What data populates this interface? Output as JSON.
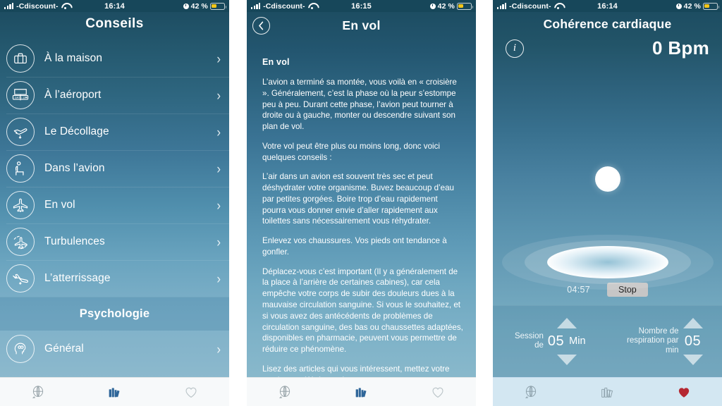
{
  "statusbars": [
    {
      "carrier": "-Cdiscount-",
      "time": "16:14",
      "battery": "42 %"
    },
    {
      "carrier": "-Cdiscount-",
      "time": "16:15",
      "battery": "42 %"
    },
    {
      "carrier": "-Cdiscount-",
      "time": "16:14",
      "battery": "42 %"
    }
  ],
  "panel1": {
    "title": "Conseils",
    "items": [
      {
        "label": "À la maison",
        "icon": "suitcase-icon",
        "chevron": "›"
      },
      {
        "label": "À l’aéroport",
        "icon": "gate-sign-icon",
        "chevron": "›"
      },
      {
        "label": "Le Décollage",
        "icon": "plane-takeoff-icon",
        "chevron": "›"
      },
      {
        "label": "Dans l’avion",
        "icon": "seat-icon",
        "chevron": "›"
      },
      {
        "label": "En vol",
        "icon": "plane-icon",
        "chevron": "›"
      },
      {
        "label": "Turbulences",
        "icon": "plane-turbulence-icon",
        "chevron": "›"
      },
      {
        "label": "L’atterrissage",
        "icon": "plane-landing-icon",
        "chevron": "›"
      }
    ],
    "section_header": "Psychologie",
    "section_items": [
      {
        "label": "Général",
        "icon": "brain-head-icon",
        "chevron": "›"
      }
    ]
  },
  "panel2": {
    "nav_title": "En vol",
    "back_glyph": "‹",
    "heading": "En vol",
    "paragraphs": [
      "L’avion a terminé sa montée, vous voilà en « croisière ». Généralement, c’est la phase où la peur s’estompe peu à peu. Durant cette phase, l’avion peut tourner à droite ou à gauche, monter ou descendre suivant son plan de vol.",
      "Votre vol peut être plus ou moins long, donc voici quelques conseils :",
      "L’air dans un avion est souvent très sec et peut déshydrater votre organisme. Buvez beaucoup d’eau par petites gorgées. Boire trop d’eau rapidement pourra vous donner envie d’aller rapidement aux toilettes sans nécessairement vous réhydrater.",
      "Enlevez vos chaussures. Vos pieds ont tendance à gonfler.",
      "Déplacez-vous c’est important (Il y a généralement de la place à l’arrière de certaines cabines), car cela empêche votre corps de subir des douleurs dues à la mauvaise circulation sanguine. Si vous le souhaitez, et si vous avez des antécédents de problèmes de circulation sanguine, des bas ou chaussettes adaptées, disponibles en pharmacie, peuvent vous permettre de réduire ce phénomène.",
      "Lisez des articles qui vous intéressent, mettez votre musique préférée ou de"
    ]
  },
  "panel3": {
    "title": "Cohérence cardiaque",
    "info_glyph": "i",
    "bpm": "0 Bpm",
    "timer": "04:57",
    "stop_label": "Stop",
    "session": {
      "label_line1": "Session",
      "label_line2": "de",
      "value": "05",
      "unit": "Min"
    },
    "breathing": {
      "label_line1": "Nombre de",
      "label_line2": "respiration par",
      "label_line3": "min",
      "value": "05"
    }
  },
  "tabbar": {
    "tabs": [
      {
        "name": "globe-icon",
        "label": ""
      },
      {
        "name": "books-icon",
        "label": ""
      },
      {
        "name": "heart-icon",
        "label": ""
      }
    ]
  },
  "colors": {
    "status_bar": "#17475a",
    "gradient_top": "#1d4d62",
    "gradient_bottom": "#8fbace",
    "tabbar_bg": "#f7f9fa",
    "tabbar_bg_active": "#d3e7f2",
    "tab_active_blue": "#2f6699",
    "tab_active_red": "#b52832",
    "battery_fill": "#f5c518",
    "stop_button": "#c6c6c6"
  }
}
